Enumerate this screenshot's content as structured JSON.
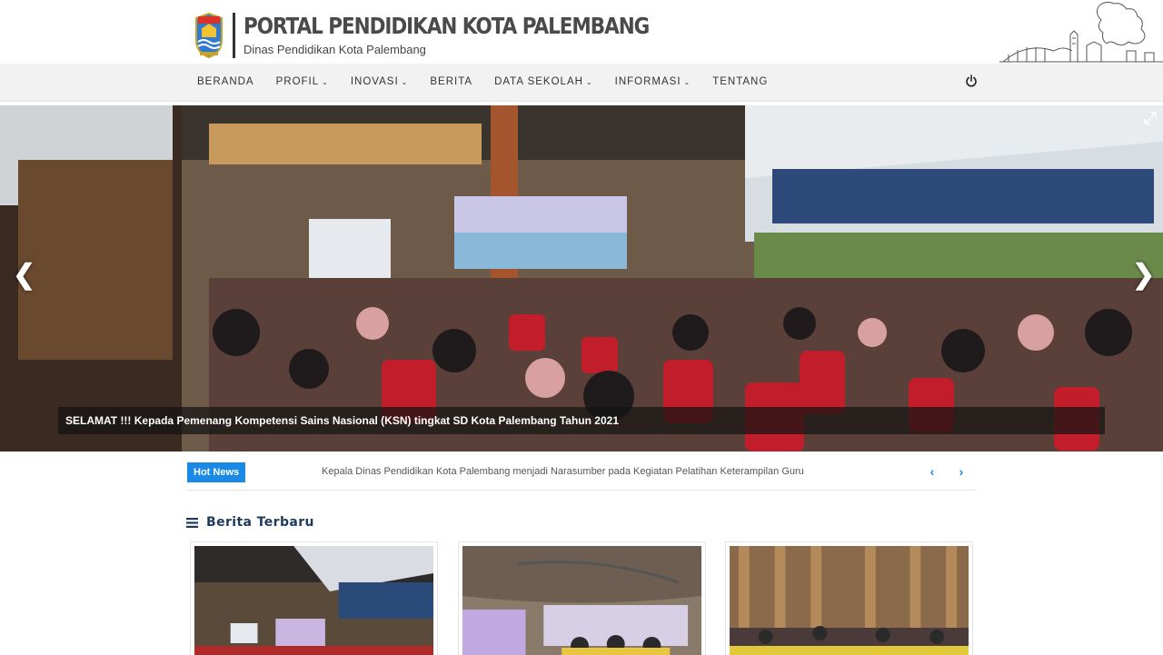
{
  "header": {
    "title": "PORTAL PENDIDIKAN KOTA PALEMBANG",
    "subtitle": "Dinas Pendidikan Kota Palembang",
    "logo_icon": "city-emblem-icon",
    "decoration_icon": "city-skyline-icon"
  },
  "nav": {
    "items": [
      {
        "label": "BERANDA",
        "dropdown": false
      },
      {
        "label": "PROFIL",
        "dropdown": true
      },
      {
        "label": "INOVASI",
        "dropdown": true
      },
      {
        "label": "BERITA",
        "dropdown": false
      },
      {
        "label": "DATA SEKOLAH",
        "dropdown": true
      },
      {
        "label": "INFORMASI",
        "dropdown": true
      },
      {
        "label": "TENTANG",
        "dropdown": false
      }
    ],
    "caret": "⌄",
    "power_icon": "power-icon"
  },
  "slider": {
    "caption": "SELAMAT !!! Kepada Pemenang Kompetensi Sains Nasional (KSN) tingkat SD Kota Palembang Tahun 2021",
    "prev": "❮",
    "next": "❯",
    "expand_icon": "expand-icon"
  },
  "hot_news": {
    "badge": "Hot News",
    "text": "Kepala Dinas Pendidikan Kota Palembang menjadi Narasumber pada Kegiatan Pelatihan Keterampilan Guru",
    "prev": "‹",
    "next": "›"
  },
  "section": {
    "title": "Berita Terbaru",
    "icon": "menu-icon"
  },
  "colors": {
    "accent": "#1a8ae6",
    "nav_bg": "#f2f2f2",
    "section_title": "#1e3a5f"
  }
}
